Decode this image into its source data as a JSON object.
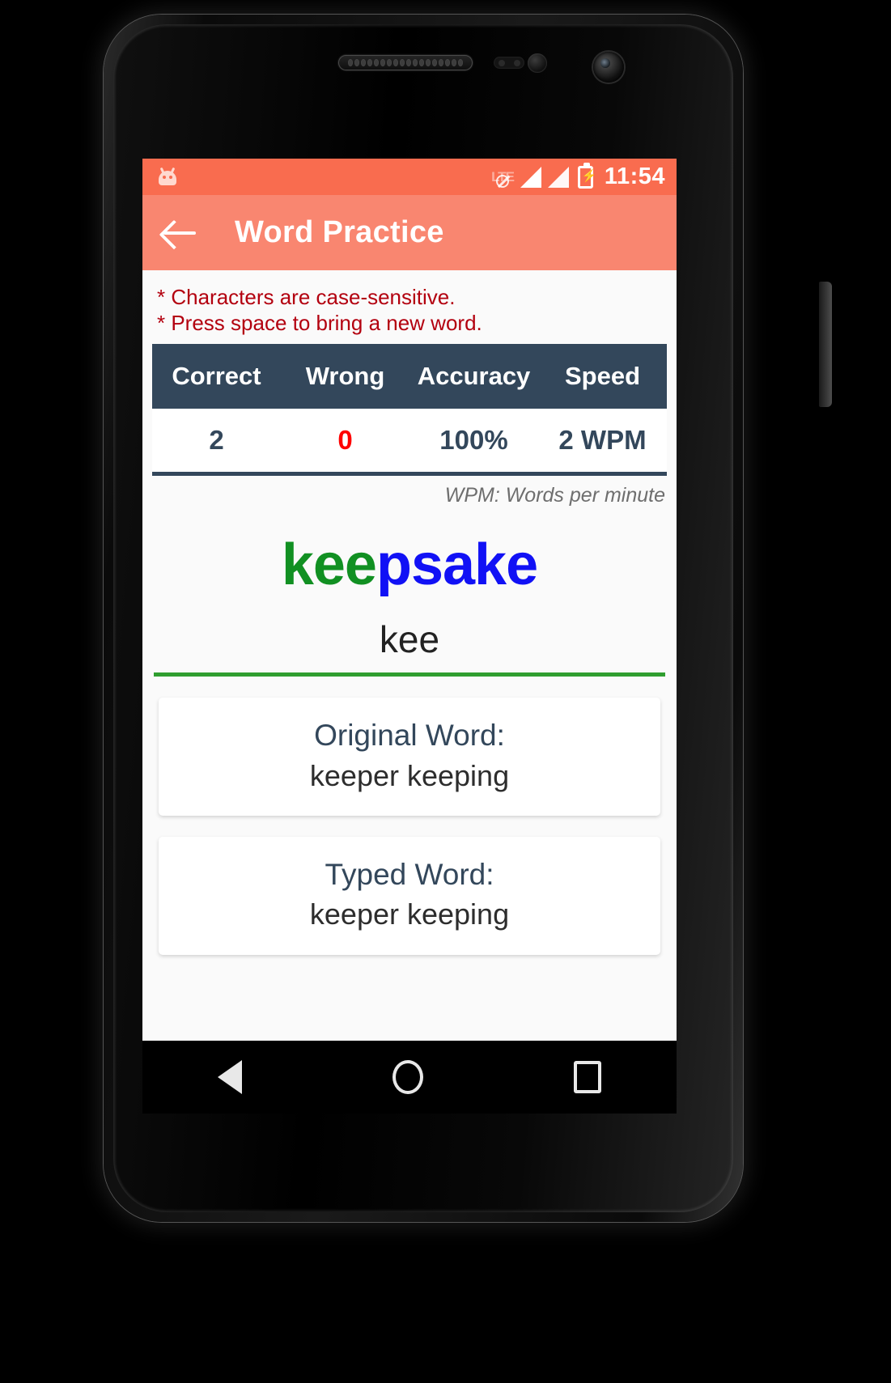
{
  "device": {
    "speaker_icon": "speaker-grille",
    "front_camera_icon": "front-camera",
    "sensor_icon": "proximity-sensor"
  },
  "statusbar": {
    "app_icon": "android-robot-icon",
    "network_label": "LTE",
    "network_blocked_icon": "no-signal-slash-icon",
    "signal1_icon": "signal-bars-icon",
    "signal2_icon": "signal-bars-icon",
    "battery_icon": "battery-charging-icon",
    "battery_bolt": "⚡",
    "time": "11:54"
  },
  "appbar": {
    "back_icon": "back-arrow-icon",
    "title": "Word Practice",
    "bg_color": "#f98670"
  },
  "notes": [
    "* Characters are case-sensitive.",
    "* Press space to bring a new word."
  ],
  "notes_color": "#b3000f",
  "stats": {
    "headers": [
      "Correct",
      "Wrong",
      "Accuracy",
      "Speed"
    ],
    "values": [
      "2",
      "0",
      "100%",
      "2 WPM"
    ],
    "header_bg": "#33475b",
    "value_color": "#33475b",
    "wrong_color": "#ff0000",
    "footnote": "WPM: Words per minute"
  },
  "word_display": {
    "full_word": "keepsake",
    "typed_part": "kee",
    "remaining_part": "psake",
    "typed_color": "#119022",
    "remaining_color": "#1111f5"
  },
  "typing_input": {
    "value": "kee",
    "placeholder": "",
    "underline_color": "#2f9e2f"
  },
  "cards": [
    {
      "label": "Original Word:",
      "value": "keeper keeping"
    },
    {
      "label": "Typed Word:",
      "value": "keeper keeping"
    }
  ],
  "navbar": {
    "back_icon": "nav-back-triangle-icon",
    "home_icon": "nav-home-circle-icon",
    "recents_icon": "nav-recents-square-icon"
  }
}
